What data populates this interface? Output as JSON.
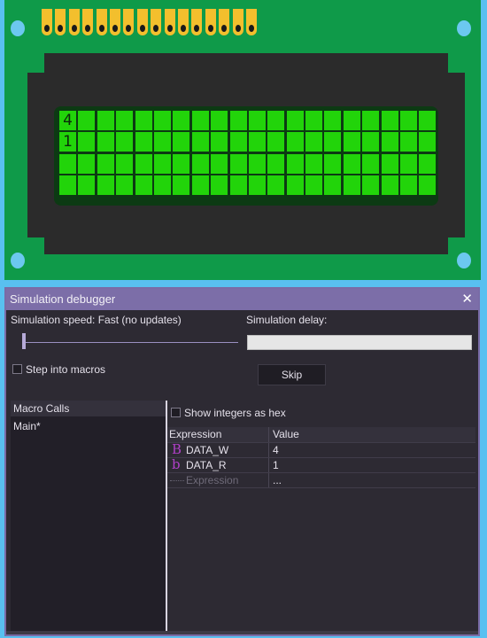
{
  "lcd": {
    "rows": [
      [
        "4",
        "",
        "",
        "",
        "",
        "",
        "",
        "",
        "",
        "",
        "",
        "",
        "",
        "",
        "",
        "",
        "",
        "",
        "",
        ""
      ],
      [
        "1",
        "",
        "",
        "",
        "",
        "",
        "",
        "",
        "",
        "",
        "",
        "",
        "",
        "",
        "",
        "",
        "",
        "",
        "",
        ""
      ],
      [
        "",
        "",
        "",
        "",
        "",
        "",
        "",
        "",
        "",
        "",
        "",
        "",
        "",
        "",
        "",
        "",
        "",
        "",
        "",
        ""
      ],
      [
        "",
        "",
        "",
        "",
        "",
        "",
        "",
        "",
        "",
        "",
        "",
        "",
        "",
        "",
        "",
        "",
        "",
        "",
        "",
        ""
      ]
    ],
    "pin_count": 16,
    "colors": {
      "pcb": "#0f9a49",
      "pixel": "#22d40a",
      "pin": "#f3bf2d"
    }
  },
  "debugger": {
    "title": "Simulation debugger",
    "close_icon": "close-icon",
    "speed_label": "Simulation speed: Fast (no updates)",
    "speed_level": 0,
    "delay_label": "Simulation delay:",
    "delay_value": "",
    "step_into_macros": {
      "label": "Step into macros",
      "checked": false
    },
    "skip_label": "Skip",
    "macro_calls": {
      "header": "Macro Calls",
      "items": [
        "Main*"
      ]
    },
    "show_integers_hex": {
      "label": "Show integers as hex",
      "checked": false
    },
    "watch_table": {
      "columns": [
        "Expression",
        "Value"
      ],
      "rows": [
        {
          "icon": "B",
          "icon_name": "byte-write-icon",
          "name": "DATA_W",
          "value": "4"
        },
        {
          "icon": "b",
          "icon_name": "byte-read-icon",
          "name": "DATA_R",
          "value": "1"
        }
      ],
      "new_row": {
        "placeholder": "Expression",
        "value": "..."
      }
    }
  }
}
